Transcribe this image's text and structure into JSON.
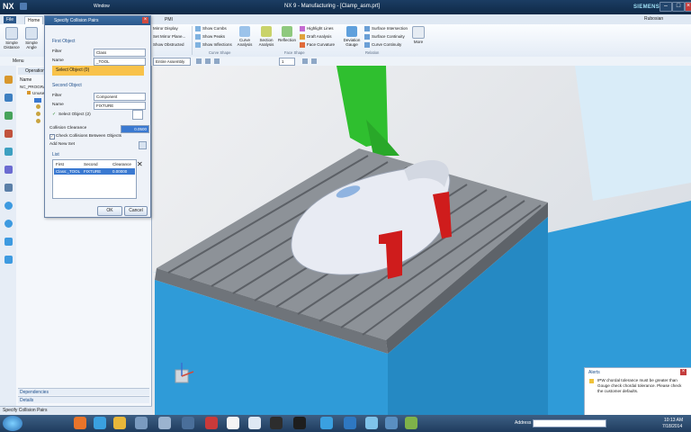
{
  "window": {
    "app_logo": "NX",
    "title": "NX 9 - Manufacturing - [Clamp_asm.prt]",
    "brand": "SIEMENS",
    "menu_window": "Window"
  },
  "tabs": [
    "File",
    "Home",
    "",
    "PMI"
  ],
  "ribbon": {
    "big_buttons": [
      "Simple Distance",
      "Simple Angle"
    ],
    "col1": [
      "Mirror Display",
      "Set Mirror Plane...",
      "Show Obstructed"
    ],
    "col2": [
      "Show Combs",
      "Show Peaks",
      "Show Inflections"
    ],
    "curve_buttons": [
      "Curve Analysis",
      "Section Analysis",
      "Reflection"
    ],
    "col3": [
      "Highlight Lines",
      "Draft Analysis",
      "Face Curvature"
    ],
    "deviation_button": "Deviation Gauge",
    "col4": [
      "Surface Intersection",
      "Surface Continuity",
      "Curve Continuity"
    ],
    "more_button": "More",
    "groups": [
      "Curve Shape",
      "Face Shape",
      "Relation"
    ]
  },
  "toolbar2": {
    "menu": "Menu",
    "filter": "Entire Assembly",
    "count": "1"
  },
  "nav": {
    "header": "Operation",
    "col": "Name",
    "root": "NC_PROGRAM",
    "items": [
      "Unused",
      "",
      "",
      ""
    ],
    "bottom": [
      "Dependencies",
      "Details"
    ]
  },
  "dialog": {
    "title": "Specify Collision Pairs",
    "first": {
      "heading": "First Object",
      "filter_lbl": "Filter",
      "filter_val": "Class",
      "name_lbl": "Name",
      "name_val": "_TOOL",
      "select": "Select Object (0)"
    },
    "second": {
      "heading": "Second Object",
      "filter_lbl": "Filter",
      "filter_val": "Component",
      "name_lbl": "Name",
      "name_val": "FIXTURE",
      "select": "Select Object (2)"
    },
    "clearance_lbl": "Collision Clearance",
    "clearance_val": "0.0500",
    "check_lbl": "Check Collisions Between Objects",
    "add_lbl": "Add New Set",
    "list": {
      "heading": "List",
      "headers": [
        "First",
        "Second",
        "Clearance"
      ],
      "rows": [
        [
          "Class:_TOOL",
          "FIXTURE",
          "0.00000"
        ]
      ]
    },
    "ok": "OK",
    "cancel": "Cancel"
  },
  "alerts": {
    "title": "Alerts",
    "message": "IPW chordal tolerance must be greater than Gouge check chordal tolerance. Please check the customer defaults."
  },
  "status": {
    "text": "Specify Collision Pairs"
  },
  "taskbar": {
    "address_lbl": "Address",
    "time": "10:13 AM",
    "date": "7/18/2014"
  },
  "colors": {
    "title_bg": "#1b3d63",
    "accent": "#2a578a",
    "table": "#8d9298",
    "fixture": "#cf1c1c",
    "base": "#2f9bd8",
    "column": "#2fbf2f",
    "list_sel": "#3a79d1"
  }
}
